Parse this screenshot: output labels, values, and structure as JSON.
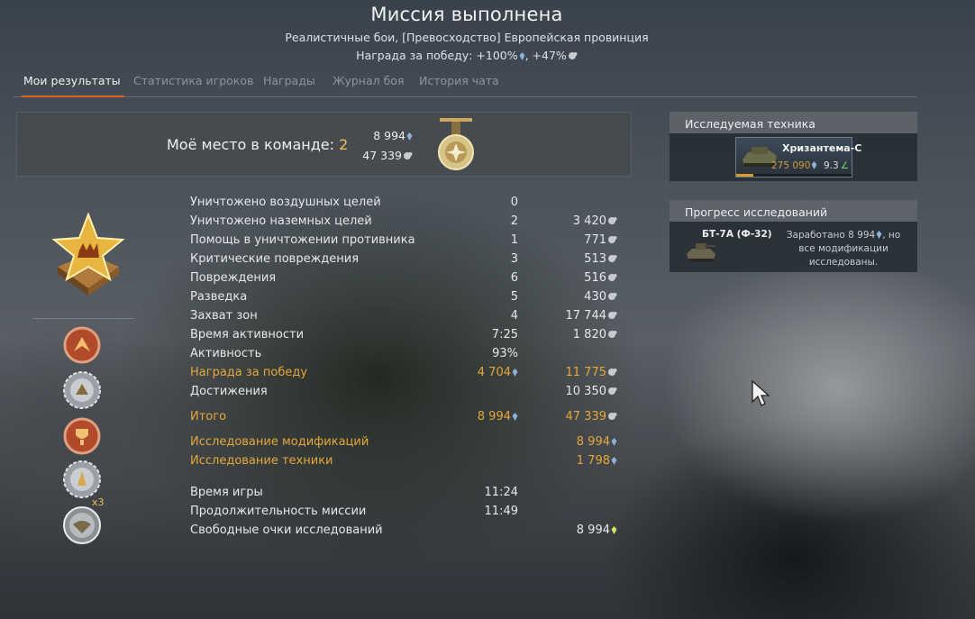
{
  "header": {
    "title": "Миссия выполнена",
    "subtitle": "Реалистичные бои, [Превосходство] Европейская провинция",
    "reward_text": "Награда за победу: +100%",
    "reward_text2": ", +47%"
  },
  "tabs": [
    {
      "label": "Мои результаты",
      "active": true
    },
    {
      "label": "Статистика игроков",
      "active": false
    },
    {
      "label": "Награды",
      "active": false
    },
    {
      "label": "Журнал боя",
      "active": false
    },
    {
      "label": "История чата",
      "active": false
    }
  ],
  "place": {
    "label": "Моё место в команде: ",
    "value": "2",
    "silver": "8 994",
    "research": "47 339"
  },
  "awards": {
    "multiplier": "x3"
  },
  "stats": [
    {
      "label": "Уничтожено воздушных целей",
      "count": "0",
      "reward": "",
      "reward_icon": "",
      "style": "normal"
    },
    {
      "label": "Уничтожено наземных целей",
      "count": "2",
      "reward": "3 420",
      "reward_icon": "rp",
      "style": "normal"
    },
    {
      "label": "Помощь в уничтожении противника",
      "count": "1",
      "reward": "771",
      "reward_icon": "rp",
      "style": "normal"
    },
    {
      "label": "Критические повреждения",
      "count": "3",
      "reward": "513",
      "reward_icon": "rp",
      "style": "normal"
    },
    {
      "label": "Повреждения",
      "count": "6",
      "reward": "516",
      "reward_icon": "rp",
      "style": "normal"
    },
    {
      "label": "Разведка",
      "count": "5",
      "reward": "430",
      "reward_icon": "rp",
      "style": "normal"
    },
    {
      "label": "Захват зон",
      "count": "4",
      "reward": "17 744",
      "reward_icon": "rp",
      "style": "normal"
    },
    {
      "label": "Время активности",
      "count": "7:25",
      "reward": "1 820",
      "reward_icon": "rp",
      "style": "normal"
    },
    {
      "label": "Активность",
      "count": "93%",
      "reward": "",
      "reward_icon": "",
      "style": "normal"
    },
    {
      "label": "Награда за победу",
      "count": "4 704",
      "count_icon": "sl",
      "reward": "11 775",
      "reward_icon": "rp",
      "style": "gold"
    },
    {
      "label": "Достижения",
      "count": "",
      "reward": "10 350",
      "reward_icon": "rp",
      "style": "normal"
    },
    {
      "label": "Итого",
      "count": "8 994",
      "count_icon": "sl",
      "reward": "47 339",
      "reward_icon": "rp",
      "style": "gold"
    },
    {
      "label": "Исследование модификаций",
      "count": "",
      "reward": "8 994",
      "reward_icon": "sl",
      "style": "gold"
    },
    {
      "label": "Исследование техники",
      "count": "",
      "reward": "1 798",
      "reward_icon": "sl",
      "style": "gold"
    },
    {
      "label": "Время игры",
      "count": "11:24",
      "reward": "",
      "reward_icon": "",
      "style": "normal"
    },
    {
      "label": "Продолжительность миссии",
      "count": "11:49",
      "reward": "",
      "reward_icon": "",
      "style": "normal"
    },
    {
      "label": "Свободные очки исследований",
      "count": "",
      "reward": "8 994",
      "reward_icon": "free",
      "style": "normal"
    }
  ],
  "researched_vehicle": {
    "header": "Исследуемая техника",
    "name": "Хризантема-С",
    "cost": "275 090",
    "br": "9.3",
    "progress_fraction": 0.15
  },
  "research_progress": {
    "header": "Прогресс исследований",
    "vehicle": "БТ-7А (Ф-32)",
    "earned": "Заработано 8 994",
    "note": ", но все модификации исследованы."
  },
  "colors": {
    "accent_orange": "#e0611e",
    "gold_text": "#e6a73a",
    "silver_icon": "#8fb0d8",
    "free_icon": "#d8e45a"
  }
}
